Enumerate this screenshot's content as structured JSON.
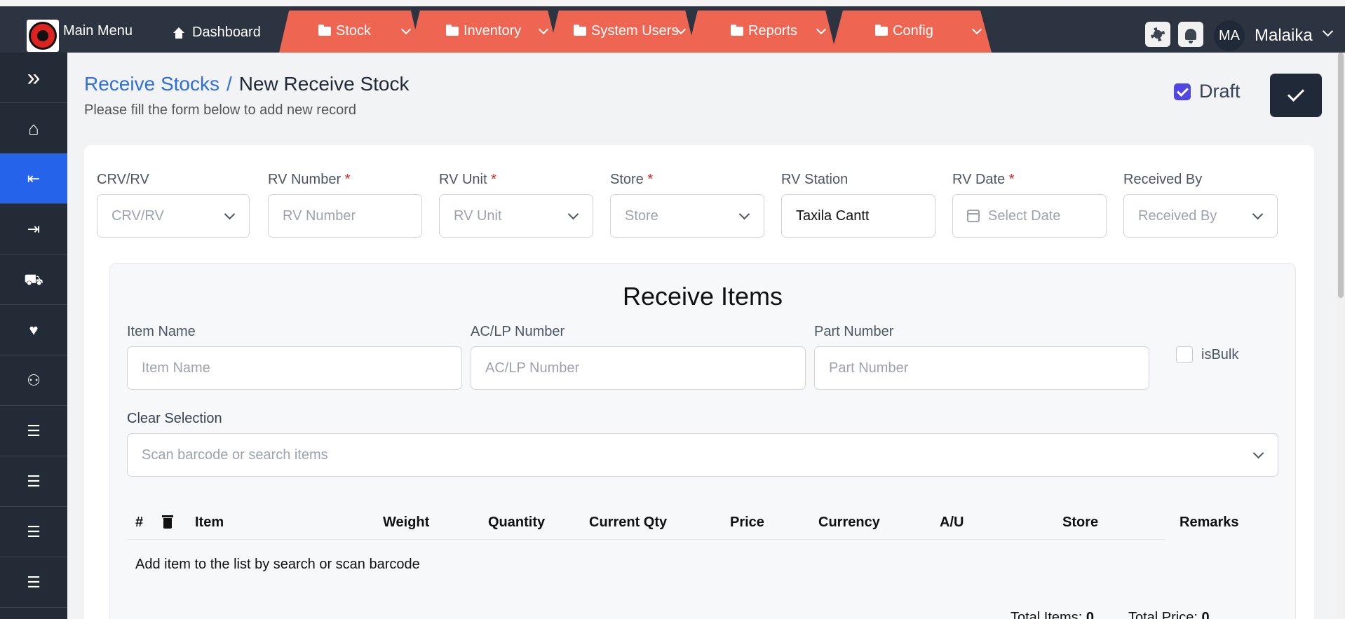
{
  "nav": {
    "main_menu": "Main Menu",
    "dashboard": "Dashboard",
    "tabs": [
      {
        "label": "Stock"
      },
      {
        "label": "Inventory"
      },
      {
        "label": "System Users"
      },
      {
        "label": "Reports"
      },
      {
        "label": "Config"
      }
    ],
    "avatar_initials": "MA",
    "username": "Malaika"
  },
  "sidebar": {
    "items": [
      {
        "icon": "expand-icon",
        "glyph": "»"
      },
      {
        "icon": "home-icon",
        "glyph": "⌂"
      },
      {
        "icon": "receive-icon",
        "glyph": "⇤"
      },
      {
        "icon": "issue-icon",
        "glyph": "⇥"
      },
      {
        "icon": "truck-icon",
        "glyph": "⛟"
      },
      {
        "icon": "heart-icon",
        "glyph": "♥"
      },
      {
        "icon": "users-icon",
        "glyph": "⚇"
      },
      {
        "icon": "layers-icon",
        "glyph": "☰"
      },
      {
        "icon": "layers-icon",
        "glyph": "☰"
      },
      {
        "icon": "layers-icon",
        "glyph": "☰"
      },
      {
        "icon": "layers-icon",
        "glyph": "☰"
      }
    ]
  },
  "page": {
    "breadcrumb_link": "Receive Stocks",
    "breadcrumb_sep": "/",
    "breadcrumb_current": "New Receive Stock",
    "subtitle": "Please fill the form below to add new record",
    "draft_label": "Draft",
    "draft_checked": true
  },
  "form": {
    "crv": {
      "label": "CRV/RV",
      "placeholder": "CRV/RV"
    },
    "rv_number": {
      "label": "RV Number",
      "placeholder": "RV Number",
      "required": "*"
    },
    "rv_unit": {
      "label": "RV Unit",
      "placeholder": "RV Unit",
      "required": "*"
    },
    "store": {
      "label": "Store",
      "placeholder": "Store",
      "required": "*"
    },
    "rv_station": {
      "label": "RV Station",
      "value": "Taxila Cantt"
    },
    "rv_date": {
      "label": "RV Date",
      "placeholder": "Select Date",
      "required": "*"
    },
    "received_by": {
      "label": "Received By",
      "placeholder": "Received By"
    }
  },
  "items": {
    "title": "Receive Items",
    "item_name": {
      "label": "Item Name",
      "placeholder": "Item Name"
    },
    "aclp": {
      "label": "AC/LP Number",
      "placeholder": "AC/LP Number"
    },
    "part": {
      "label": "Part Number",
      "placeholder": "Part Number"
    },
    "is_bulk": "isBulk",
    "clear_selection": "Clear Selection",
    "search_placeholder": "Scan barcode or search items",
    "columns": [
      "#",
      "Item",
      "Weight",
      "Quantity",
      "Current Qty",
      "Price",
      "Currency",
      "A/U",
      "Store",
      "Remarks"
    ],
    "empty_message": "Add item to the list by search or scan barcode",
    "total_items_label": "Total Items:",
    "total_items": "0",
    "total_price_label": "Total Price:",
    "total_price": "0"
  },
  "colors": {
    "topbar": "#2b3440",
    "tab_accent": "#ee6552",
    "sidebar": "#232b36",
    "sidebar_active": "#2563eb",
    "link": "#2f6fdc"
  }
}
